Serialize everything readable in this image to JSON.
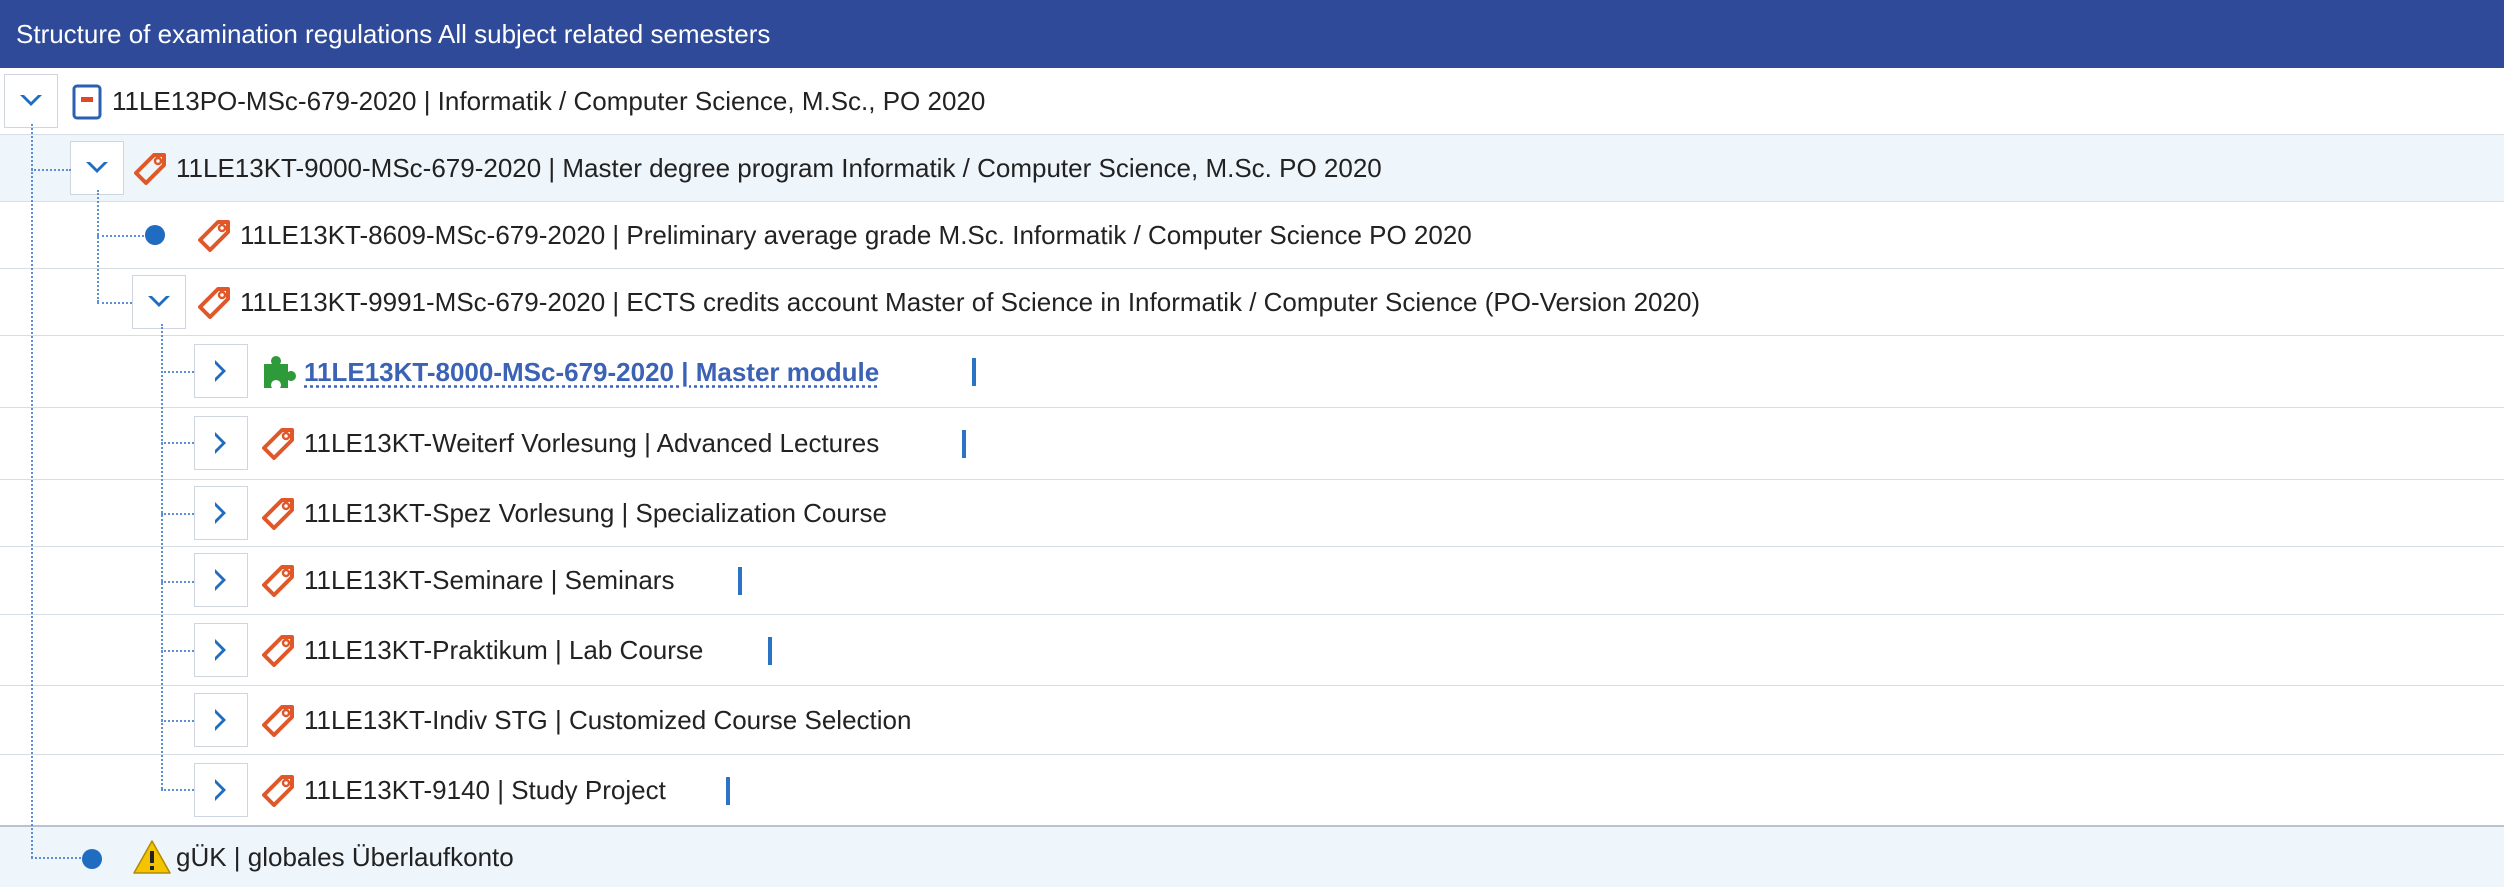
{
  "header": {
    "title": "Structure of examination regulations All subject related semesters"
  },
  "tree": {
    "root": {
      "label": "11LE13PO-MSc-679-2020 | Informatik / Computer Science, M.Sc., PO 2020"
    },
    "program": {
      "label": "11LE13KT-9000-MSc-679-2020 | Master degree program Informatik / Computer Science, M.Sc. PO 2020"
    },
    "grade": {
      "label": "11LE13KT-8609-MSc-679-2020 | Preliminary average grade M.Sc. Informatik / Computer Science PO 2020"
    },
    "ects": {
      "label": "11LE13KT-9991-MSc-679-2020 | ECTS credits account Master of Science in Informatik / Computer Science (PO-Version 2020)"
    },
    "children": [
      {
        "label": "11LE13KT-8000-MSc-679-2020 | Master module",
        "icon": "puzzle-icon"
      },
      {
        "label": "11LE13KT-Weiterf Vorlesung | Advanced Lectures",
        "icon": "tag-icon"
      },
      {
        "label": "11LE13KT-Spez Vorlesung | Specialization Course",
        "icon": "tag-icon"
      },
      {
        "label": "11LE13KT-Seminare | Seminars",
        "icon": "tag-icon"
      },
      {
        "label": "11LE13KT-Praktikum | Lab Course",
        "icon": "tag-icon"
      },
      {
        "label": "11LE13KT-Indiv STG | Customized Course Selection",
        "icon": "tag-icon"
      },
      {
        "label": "11LE13KT-9140 | Study Project",
        "icon": "tag-icon"
      }
    ],
    "overflow": {
      "label": "gÜK | globales Überlaufkonto",
      "icon": "warning-icon"
    }
  },
  "colors": {
    "header_bg": "#2f4a98",
    "link": "#3b62b4",
    "accent": "#1f6cc1",
    "tag": "#e0582a",
    "puzzle": "#2f9a3a",
    "warning": "#f5c400"
  }
}
